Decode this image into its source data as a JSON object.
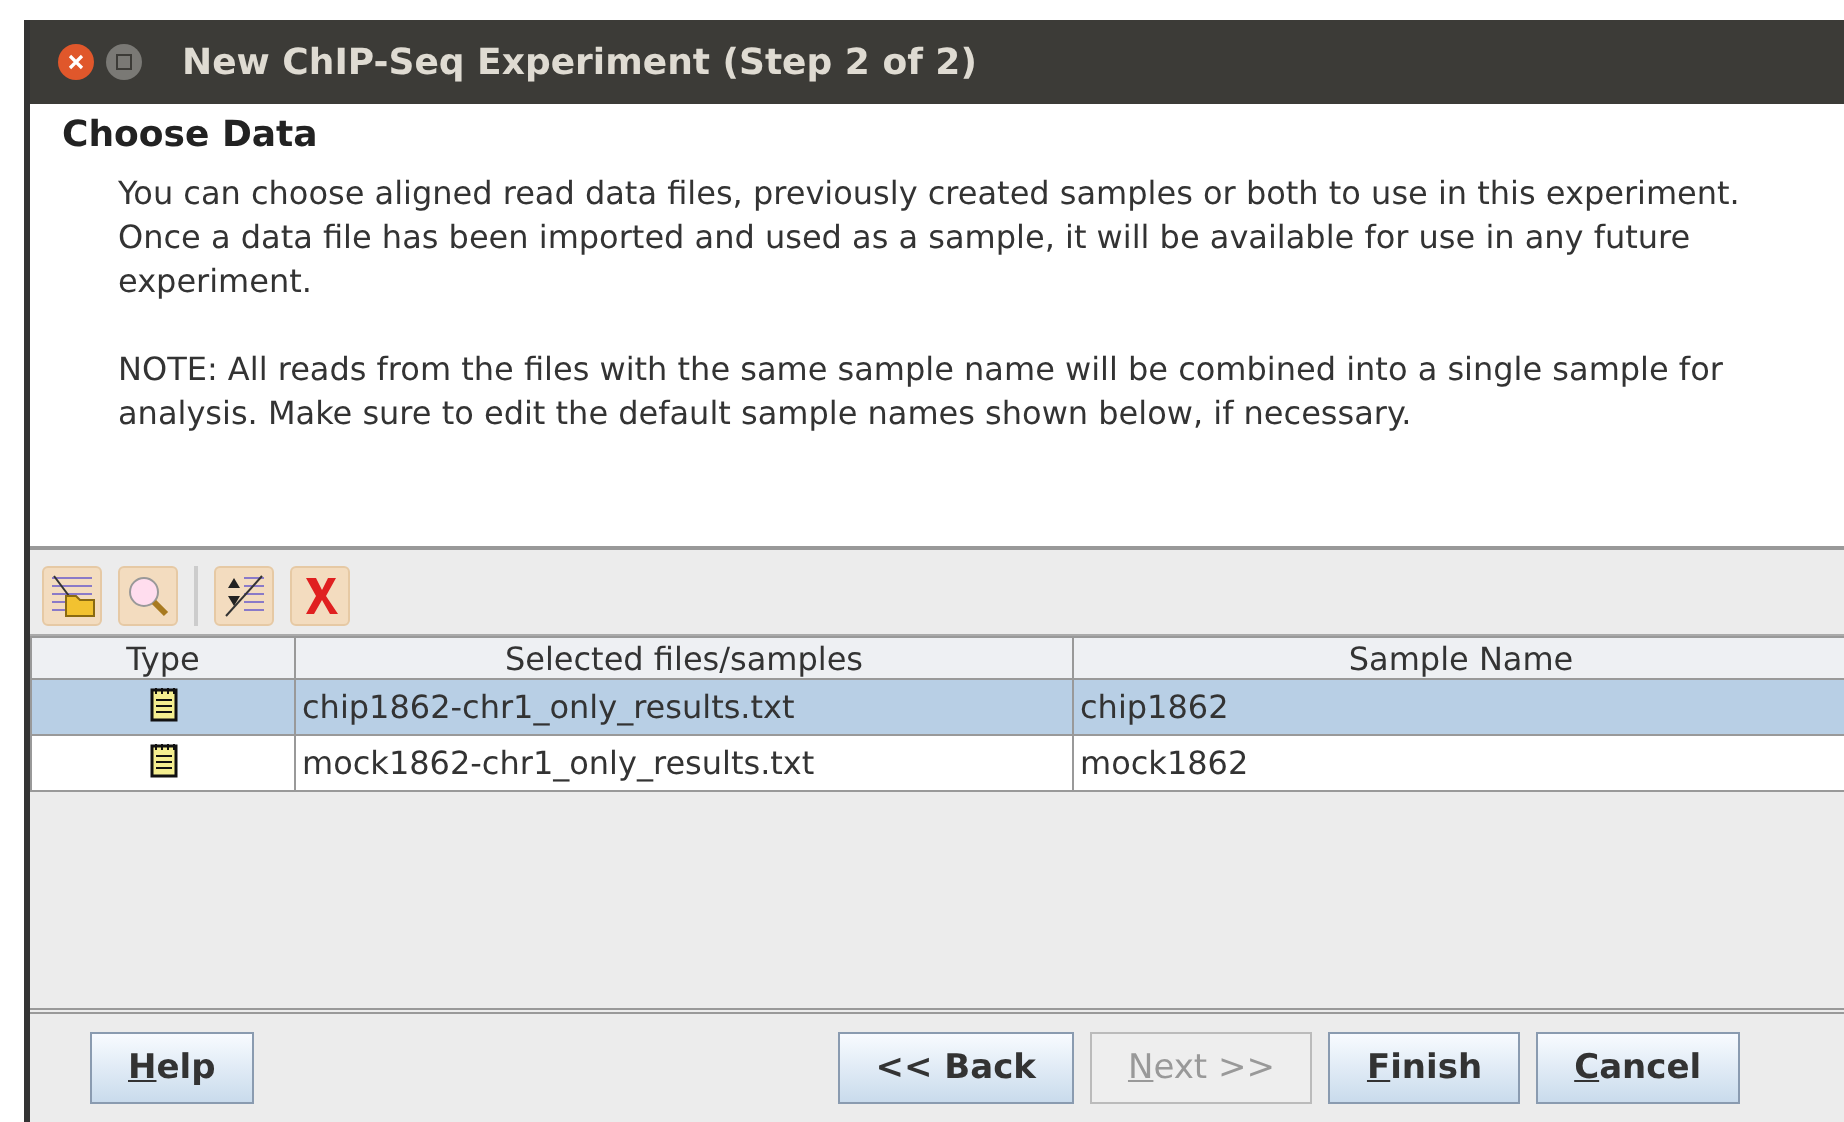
{
  "window": {
    "title": "New ChIP-Seq Experiment (Step 2 of 2)"
  },
  "heading": "Choose Data",
  "paragraphs": [
    "You can choose aligned read data files, previously created samples or both to use in this experiment. Once a data file has been imported and used as a sample, it will be available for use in any future experiment.",
    "NOTE: All reads from the files with the same sample name will be combined into a single sample for analysis. Make sure to edit the default sample names shown below, if necessary."
  ],
  "toolbar": [
    {
      "kind": "add"
    },
    {
      "kind": "search"
    },
    {
      "kind": "sort"
    },
    {
      "kind": "remove"
    }
  ],
  "table": {
    "columns": [
      "Type",
      "Selected files/samples",
      "Sample Name"
    ],
    "rows": [
      {
        "file": "chip1862-chr1_only_results.txt",
        "sample": "chip1862",
        "selected": true
      },
      {
        "file": "mock1862-chr1_only_results.txt",
        "sample": "mock1862",
        "selected": false
      }
    ]
  },
  "buttons": [
    {
      "label": "Help",
      "underlined_first": true,
      "disabled": false
    },
    {
      "label": "<< Back",
      "underlined_first": false,
      "disabled": false
    },
    {
      "label": "Next >>",
      "underlined_first": true,
      "disabled": true
    },
    {
      "label": "Finish",
      "underlined_first": true,
      "disabled": false
    },
    {
      "label": "Cancel",
      "underlined_first": true,
      "disabled": false
    }
  ]
}
